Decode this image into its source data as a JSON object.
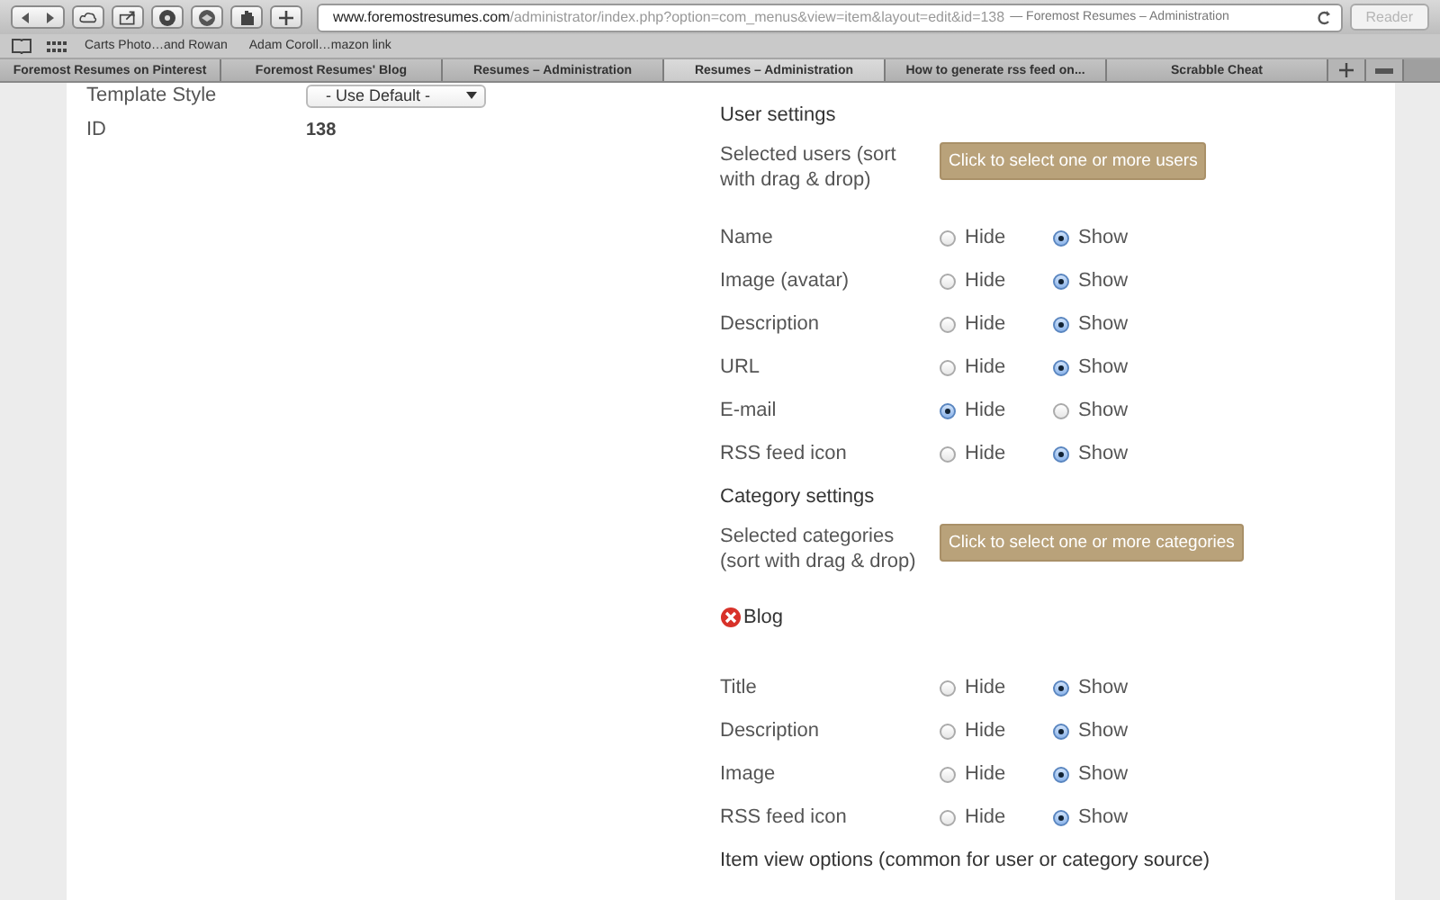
{
  "browser": {
    "url_host": "www.foremostresumes.com",
    "url_path": "/administrator/index.php?option=com_menus&view=item&layout=edit&id=138",
    "page_title": "— Foremost Resumes – Administration",
    "reader": "Reader",
    "bookmarks": [
      "Carts Photo…and Rowan",
      "Adam Coroll…mazon link"
    ],
    "tabs": [
      {
        "label": "Foremost Resumes on Pinterest",
        "selected": false
      },
      {
        "label": "Foremost Resumes' Blog",
        "selected": false
      },
      {
        "label": "Resumes – Administration",
        "selected": false
      },
      {
        "label": "Resumes – Administration",
        "selected": true
      },
      {
        "label": "How to generate rss feed on...",
        "selected": false
      },
      {
        "label": "Scrabble Cheat",
        "selected": false
      }
    ]
  },
  "left_fields": [
    {
      "kind": "select",
      "label": "Template Style",
      "value": "- Use Default -"
    },
    {
      "kind": "text",
      "label": "ID",
      "value": "138"
    }
  ],
  "right_rows": [
    {
      "kind": "heading",
      "text": "User settings"
    },
    {
      "kind": "picker",
      "label": "Selected users (sort with drag & drop)",
      "button": "Click to select one or more users"
    },
    {
      "kind": "radio",
      "label": "Name",
      "options": [
        {
          "label": "Hide",
          "selected": false
        },
        {
          "label": "Show",
          "selected": true
        }
      ]
    },
    {
      "kind": "radio",
      "label": "Image (avatar)",
      "options": [
        {
          "label": "Hide",
          "selected": false
        },
        {
          "label": "Show",
          "selected": true
        }
      ]
    },
    {
      "kind": "radio",
      "label": "Description",
      "options": [
        {
          "label": "Hide",
          "selected": false
        },
        {
          "label": "Show",
          "selected": true
        }
      ]
    },
    {
      "kind": "radio",
      "label": "URL",
      "options": [
        {
          "label": "Hide",
          "selected": false
        },
        {
          "label": "Show",
          "selected": true
        }
      ]
    },
    {
      "kind": "radio",
      "label": "E-mail",
      "options": [
        {
          "label": "Hide",
          "selected": true
        },
        {
          "label": "Show",
          "selected": false
        }
      ]
    },
    {
      "kind": "radio",
      "label": "RSS feed icon",
      "options": [
        {
          "label": "Hide",
          "selected": false
        },
        {
          "label": "Show",
          "selected": true
        }
      ]
    },
    {
      "kind": "heading",
      "text": "Category settings"
    },
    {
      "kind": "picker",
      "label": "Selected categories (sort with drag & drop)",
      "button": "Click to select one or more categories"
    },
    {
      "kind": "tag",
      "text": "Blog"
    },
    {
      "kind": "radio",
      "label": "Title",
      "options": [
        {
          "label": "Hide",
          "selected": false
        },
        {
          "label": "Show",
          "selected": true
        }
      ]
    },
    {
      "kind": "radio",
      "label": "Description",
      "options": [
        {
          "label": "Hide",
          "selected": false
        },
        {
          "label": "Show",
          "selected": true
        }
      ]
    },
    {
      "kind": "radio",
      "label": "Image",
      "options": [
        {
          "label": "Hide",
          "selected": false
        },
        {
          "label": "Show",
          "selected": true
        }
      ]
    },
    {
      "kind": "radio",
      "label": "RSS feed icon",
      "options": [
        {
          "label": "Hide",
          "selected": false
        },
        {
          "label": "Show",
          "selected": true
        }
      ]
    },
    {
      "kind": "heading",
      "text": "Item view options (common for user or category source)"
    }
  ]
}
